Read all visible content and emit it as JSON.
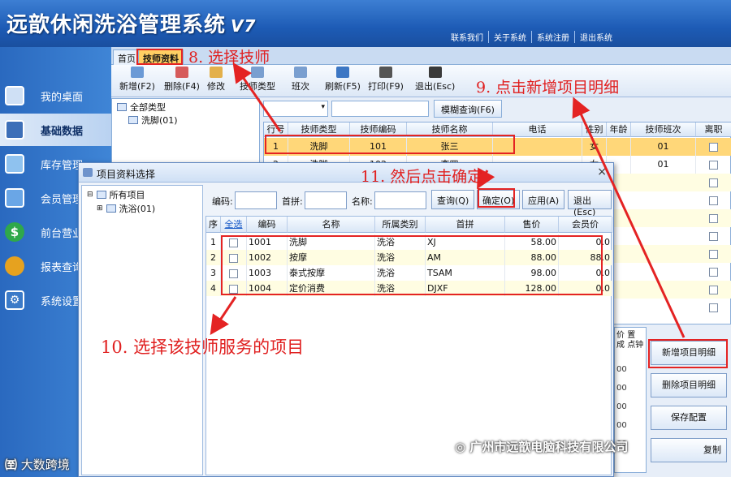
{
  "header": {
    "title": "远歆休闲洗浴管理系统",
    "version": "V7",
    "links": [
      "联系我们",
      "关于系统",
      "系统注册",
      "退出系统"
    ]
  },
  "nav": {
    "items": [
      {
        "label": "我的桌面",
        "icon": "monitor-icon",
        "color": "#5b8fd6"
      },
      {
        "label": "基础数据",
        "icon": "data-grid-icon",
        "color": "#3d6fb8",
        "active": true
      },
      {
        "label": "库存管理",
        "icon": "warehouse-icon",
        "color": "#5aa0e0"
      },
      {
        "label": "会员管理",
        "icon": "member-card-icon",
        "color": "#4a8ed8"
      },
      {
        "label": "前台营业",
        "icon": "dollar-icon",
        "color": "#2fa84a"
      },
      {
        "label": "报表查询",
        "icon": "leaf-icon",
        "color": "#e6a21f"
      },
      {
        "label": "系统设置",
        "icon": "settings-icon",
        "color": "#3b7ac8"
      }
    ]
  },
  "tabs": [
    "首页",
    "技师资料"
  ],
  "toolbar": {
    "buttons": [
      "新增(F2)",
      "删除(F4)",
      "修改",
      "技师类型",
      "班次",
      "刷新(F5)",
      "打印(F9)",
      "退出(Esc)"
    ]
  },
  "tree": {
    "root": "全部类型",
    "child": "洗脚(01)"
  },
  "filter": {
    "search_button": "模糊查询(F6)"
  },
  "grid": {
    "headers": [
      "行号",
      "技师类型",
      "技师编码",
      "技师名称",
      "电话",
      "性别",
      "年龄",
      "技师班次",
      "离职"
    ],
    "rows": [
      {
        "no": "1",
        "type": "洗脚",
        "code": "101",
        "name": "张三",
        "phone": "",
        "sex": "女",
        "age": "",
        "shift": "01"
      },
      {
        "no": "2",
        "type": "洗脚",
        "code": "102",
        "name": "李四",
        "phone": "",
        "sex": "女",
        "age": "",
        "shift": "01"
      }
    ],
    "lower_partial_headers": [
      "价",
      "置",
      "成",
      "点钟"
    ]
  },
  "side_buttons": [
    "新增项目明细",
    "删除项目明细",
    "保存配置",
    "复制"
  ],
  "dialog": {
    "title": "项目资料选择",
    "close": "×",
    "tree_root": "所有项目",
    "tree_child": "洗浴(01)",
    "search_labels": {
      "code": "编码:",
      "pinyin": "首拼:",
      "name": "名称:"
    },
    "buttons": [
      "查询(Q)",
      "确定(O)",
      "应用(A)",
      "退出(Esc)"
    ],
    "headers": [
      "序",
      "全选",
      "编码",
      "名称",
      "所属类别",
      "首拼",
      "售价",
      "会员价"
    ],
    "rows": [
      {
        "no": "1",
        "code": "1001",
        "name": "洗脚",
        "cat": "洗浴",
        "py": "XJ",
        "price": "58.00",
        "member": "0.0"
      },
      {
        "no": "2",
        "code": "1002",
        "name": "按摩",
        "cat": "洗浴",
        "py": "AM",
        "price": "88.00",
        "member": "88.0"
      },
      {
        "no": "3",
        "code": "1003",
        "name": "泰式按摩",
        "cat": "洗浴",
        "py": "TSAM",
        "price": "98.00",
        "member": "0.0"
      },
      {
        "no": "4",
        "code": "1004",
        "name": "定价消费",
        "cat": "洗浴",
        "py": "DJXF",
        "price": "128.00",
        "member": "0.0"
      }
    ]
  },
  "annotations": {
    "a8": "8. 选择技师",
    "a9": "9. 点击新增项目明细",
    "a10": "10. 选择该技师服务的项目",
    "a11": "11. 然后点击确定"
  },
  "watermarks": {
    "left": "大数跨境",
    "right": "广州市远歆电脑科技有限公司"
  },
  "colors": {
    "annotation": "#e42323",
    "selected_row": "#ffd779",
    "active_tab": "#ffcf63"
  }
}
